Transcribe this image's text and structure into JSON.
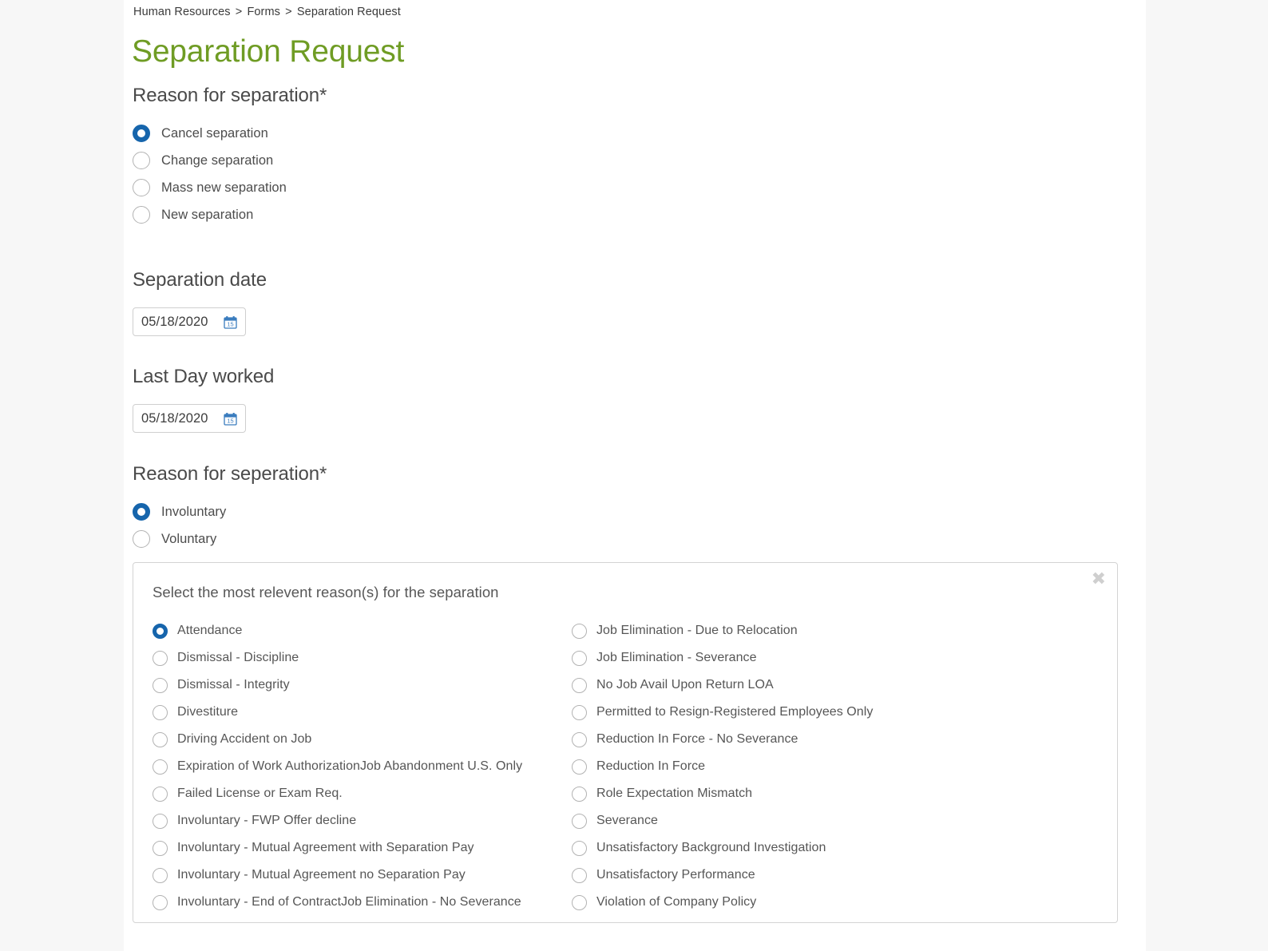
{
  "breadcrumb": {
    "items": [
      "Human Resources",
      "Forms",
      "Separation Request"
    ],
    "separator": ">"
  },
  "page_title": "Separation Request",
  "sections": {
    "reason_for_separation": {
      "heading": "Reason for separation*",
      "options": [
        "Cancel separation",
        "Change separation",
        "Mass new separation",
        "New separation"
      ],
      "selected_index": 0
    },
    "separation_date": {
      "heading": "Separation date",
      "value": "05/18/2020",
      "icon": "calendar-icon",
      "icon_day": "15"
    },
    "last_day_worked": {
      "heading": "Last Day worked",
      "value": "05/18/2020",
      "icon": "calendar-icon",
      "icon_day": "15"
    },
    "reason_for_seperation": {
      "heading": "Reason for seperation*",
      "options": [
        "Involuntary",
        "Voluntary"
      ],
      "selected_index": 0
    }
  },
  "reasons_panel": {
    "prompt": "Select the most relevent reason(s) for the separation",
    "close_icon": "close-icon",
    "close_glyph": "✖",
    "selected_left_index": 0,
    "selected_right_index": -1,
    "left_options": [
      "Attendance",
      "Dismissal - Discipline",
      "Dismissal - Integrity",
      "Divestiture",
      "Driving Accident on Job",
      "Expiration of Work AuthorizationJob Abandonment U.S. Only",
      "Failed License or Exam Req.",
      "Involuntary - FWP Offer decline",
      "Involuntary - Mutual Agreement with Separation Pay",
      "Involuntary - Mutual Agreement no Separation Pay",
      "Involuntary - End of ContractJob Elimination - No Severance"
    ],
    "right_options": [
      "Job Elimination - Due to Relocation",
      "Job Elimination - Severance",
      "No Job Avail Upon Return LOA",
      "Permitted to Resign-Registered Employees Only",
      "Reduction In Force - No Severance",
      "Reduction In Force",
      "Role Expectation Mismatch",
      "Severance",
      "Unsatisfactory Background Investigation",
      "Unsatisfactory Performance",
      "Violation of Company Policy"
    ]
  },
  "colors": {
    "title_green": "#6f9c24",
    "radio_selected_blue": "#1665ac",
    "calendar_blue": "#3a7cbe",
    "text_gray": "#4c4c4c",
    "border_gray": "#d3d3d3",
    "page_background": "#f7f7f7"
  }
}
